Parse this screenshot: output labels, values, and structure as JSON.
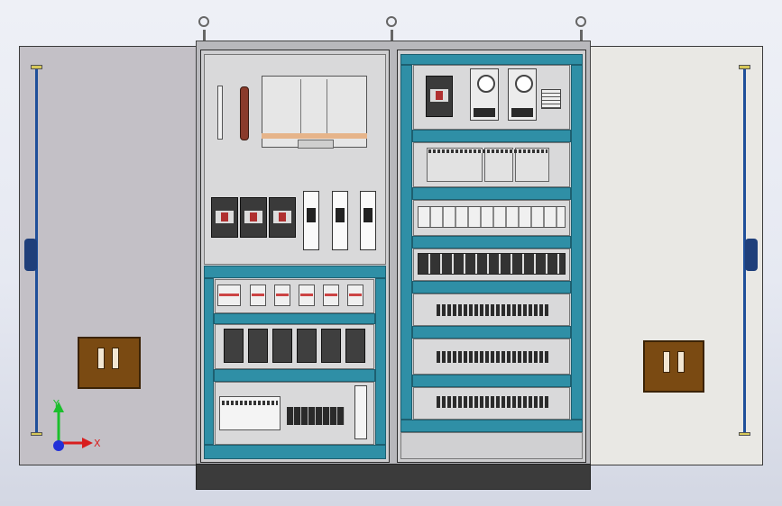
{
  "triad": {
    "x_label": "X",
    "y_label": "Y"
  },
  "colors": {
    "rail": "#2f8fa6",
    "door_left": "#c3c0c6",
    "door_right": "#e9e8e4",
    "handle": "#7a4a12",
    "rod": "#1f4f9a",
    "axis_x": "#d81e1e",
    "axis_y": "#1bbf2c",
    "axis_z": "#2230d8"
  }
}
